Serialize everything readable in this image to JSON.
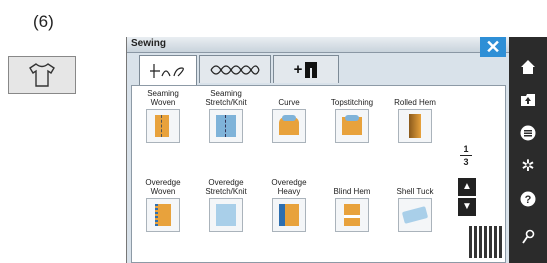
{
  "step_label": "(6)",
  "panel": {
    "title": "Sewing",
    "close_glyph": "✕",
    "tabs": [
      {
        "label": "",
        "icon": "utility-stitch-icon",
        "active": true
      },
      {
        "label": "",
        "icon": "decorative-stitch-icon",
        "active": false
      },
      {
        "label": "+",
        "icon": "presser-foot-icon",
        "active": false
      }
    ],
    "stitches": [
      {
        "label": "Seaming\nWoven",
        "icon": "seaming-woven-icon"
      },
      {
        "label": "Seaming\nStretch/Knit",
        "icon": "seaming-stretch-icon"
      },
      {
        "label": "Curve",
        "icon": "curve-icon"
      },
      {
        "label": "Topstitching",
        "icon": "topstitching-icon"
      },
      {
        "label": "Rolled Hem",
        "icon": "rolled-hem-icon"
      },
      {
        "label": "Overedge\nWoven",
        "icon": "overedge-woven-icon"
      },
      {
        "label": "Overedge\nStretch/Knit",
        "icon": "overedge-stretch-icon"
      },
      {
        "label": "Overedge\nHeavy",
        "icon": "overedge-heavy-icon"
      },
      {
        "label": "Blind Hem",
        "icon": "blind-hem-icon"
      },
      {
        "label": "Shell Tuck",
        "icon": "shell-tuck-icon"
      }
    ],
    "page_current": "1",
    "page_total": "3"
  },
  "sidebar": [
    "home-icon",
    "import-icon",
    "menu-icon",
    "settings-icon",
    "help-icon",
    "tools-icon"
  ],
  "colors": {
    "accent": "#2e8fd6",
    "sidebar": "#2b2b2b",
    "fabric": "#e8a23c"
  }
}
